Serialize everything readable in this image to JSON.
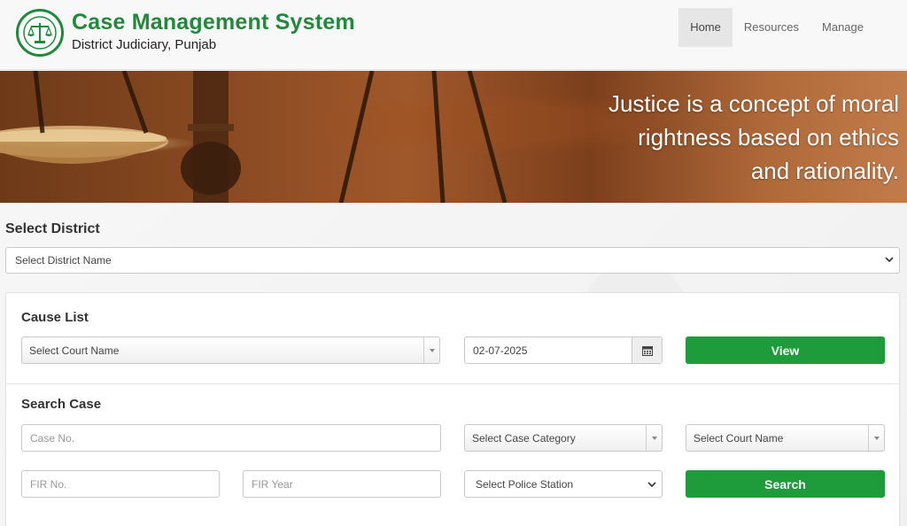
{
  "header": {
    "title": "Case Management System",
    "subtitle": "District Judiciary, Punjab",
    "nav": [
      {
        "label": "Home",
        "active": true
      },
      {
        "label": "Resources",
        "active": false
      },
      {
        "label": "Manage",
        "active": false
      }
    ]
  },
  "banner": {
    "quote_lines": [
      "Justice is a concept of moral",
      "rightness based on ethics",
      "and rationality."
    ]
  },
  "district": {
    "label": "Select District",
    "select_value": "Select District Name"
  },
  "cause_list": {
    "title": "Cause List",
    "court_select": "Select Court Name",
    "date_value": "02-07-2025",
    "view_button": "View"
  },
  "search_case": {
    "title": "Search Case",
    "case_no_placeholder": "Case No.",
    "case_category_select": "Select Case Category",
    "court_select": "Select Court Name",
    "fir_no_placeholder": "FIR No.",
    "fir_year_placeholder": "FIR Year",
    "police_station_select": "Select Police Station",
    "search_button": "Search"
  },
  "colors": {
    "brand_green": "#1f8a3a",
    "button_green": "#1e9b3a"
  },
  "icons": {
    "logo": "scales-of-justice-icon",
    "calendar": "calendar-icon",
    "dropdown": "chevron-down-icon"
  }
}
